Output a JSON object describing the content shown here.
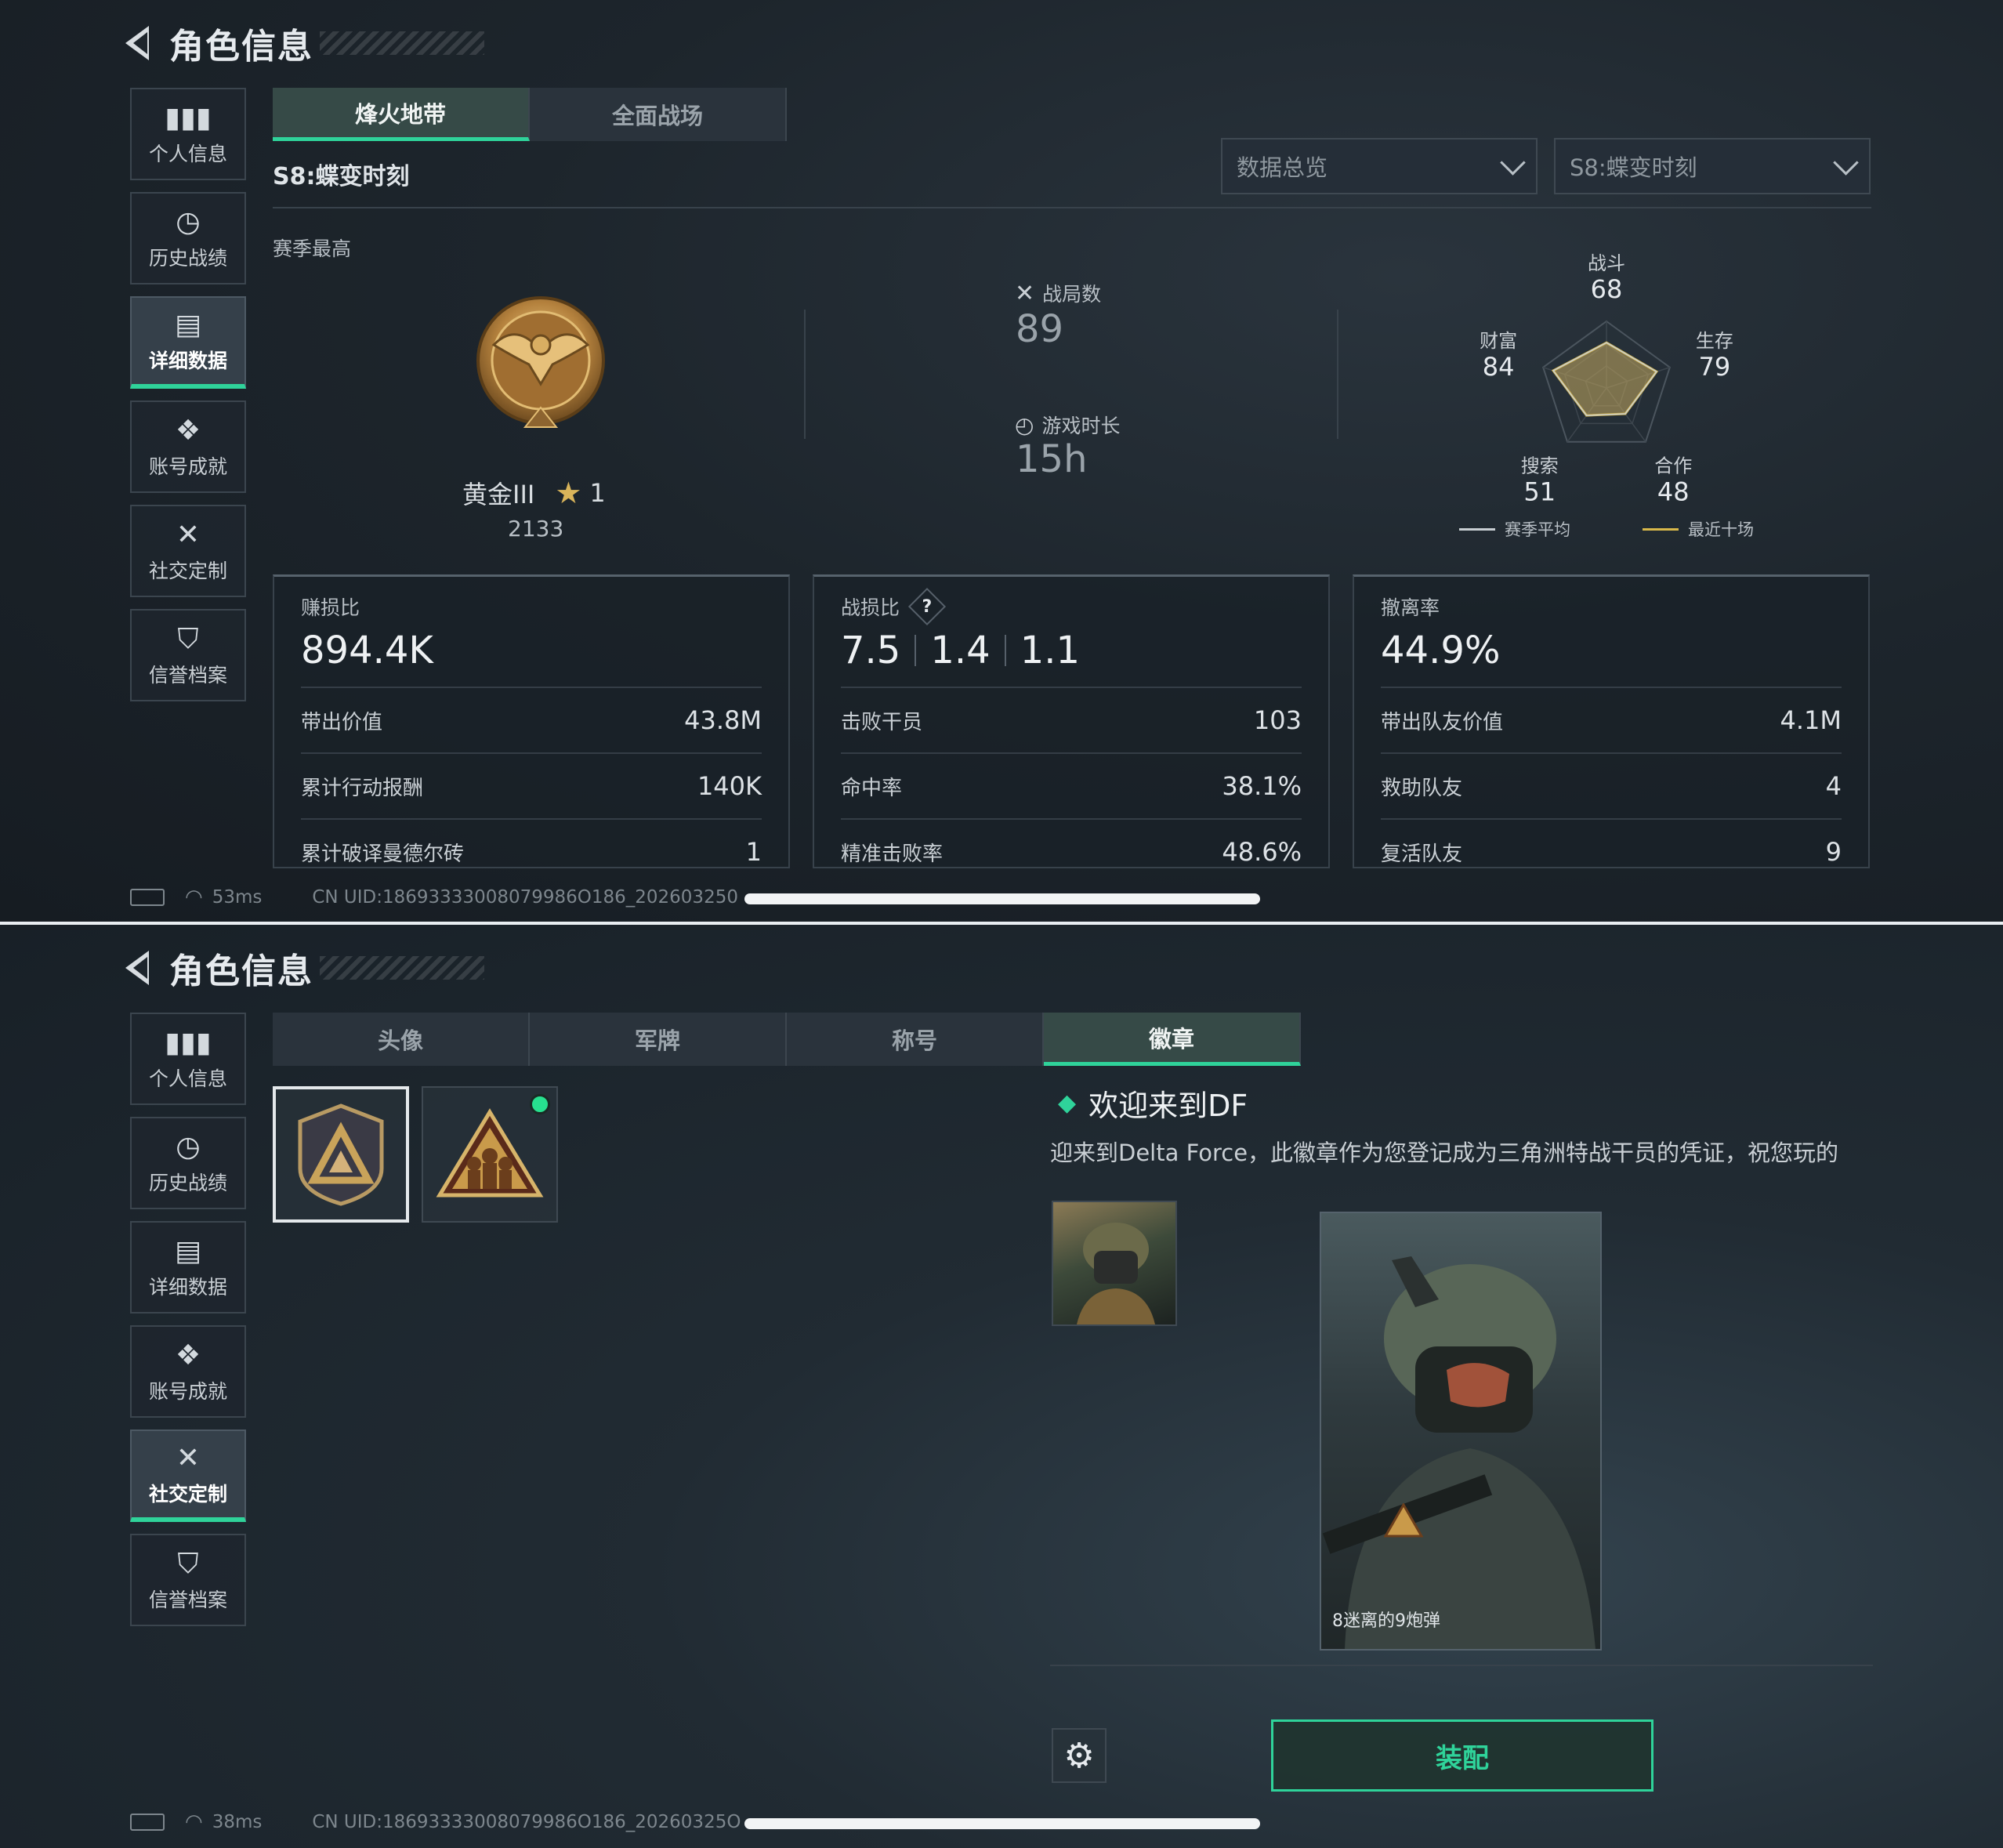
{
  "header": {
    "title": "角色信息"
  },
  "sidebar": {
    "items": [
      {
        "label": "个人信息",
        "icon": "bar-chart-icon"
      },
      {
        "label": "历史战绩",
        "icon": "clock-icon"
      },
      {
        "label": "详细数据",
        "icon": "cards-icon"
      },
      {
        "label": "账号成就",
        "icon": "medal-icon"
      },
      {
        "label": "社交定制",
        "icon": "tools-icon"
      },
      {
        "label": "信誉档案",
        "icon": "shield-icon"
      }
    ]
  },
  "screen1": {
    "tabs": [
      "烽火地带",
      "全面战场"
    ],
    "season_label": "S8:蝶变时刻",
    "dropdown_overview": "数据总览",
    "dropdown_season": "S8:蝶变时刻",
    "season_best_label": "赛季最高",
    "rank_name": "黄金III",
    "rank_stars": "1",
    "rank_score": "2133",
    "matches_label": "战局数",
    "matches_value": "89",
    "playtime_label": "游戏时长",
    "playtime_value": "15h",
    "radar": {
      "axes": [
        {
          "label": "战斗",
          "value": "68",
          "score": 0.68
        },
        {
          "label": "生存",
          "value": "79",
          "score": 0.79
        },
        {
          "label": "合作",
          "value": "48",
          "score": 0.48
        },
        {
          "label": "搜索",
          "value": "51",
          "score": 0.51
        },
        {
          "label": "财富",
          "value": "84",
          "score": 0.84
        }
      ],
      "legend_season": "赛季平均",
      "legend_recent": "最近十场",
      "color_season": "#c8ced3",
      "color_recent": "#d8b84a"
    },
    "cards": [
      {
        "title": "赚损比",
        "big": "894.4K",
        "rows": [
          {
            "label": "带出价值",
            "value": "43.8M"
          },
          {
            "label": "累计行动报酬",
            "value": "140K"
          },
          {
            "label": "累计破译曼德尔砖",
            "value": "1"
          }
        ]
      },
      {
        "title": "战损比",
        "help": "?",
        "big_parts": [
          "7.5",
          "1.4",
          "1.1"
        ],
        "rows": [
          {
            "label": "击败干员",
            "value": "103"
          },
          {
            "label": "命中率",
            "value": "38.1%"
          },
          {
            "label": "精准击败率",
            "value": "48.6%"
          }
        ]
      },
      {
        "title": "撤离率",
        "big": "44.9%",
        "rows": [
          {
            "label": "带出队友价值",
            "value": "4.1M"
          },
          {
            "label": "救助队友",
            "value": "4"
          },
          {
            "label": "复活队友",
            "value": "9"
          }
        ]
      }
    ],
    "ping": "53ms",
    "uid": "CN UID:18693333008079986O186_202603250"
  },
  "screen2": {
    "tabs": [
      "头像",
      "军牌",
      "称号",
      "徽章"
    ],
    "badge_title": "欢迎来到DF",
    "badge_desc": "迎来到Delta Force，此徽章作为您登记成为三角洲特战干员的凭证，祝您玩的",
    "card_caption": "8迷离的9炮弹",
    "equip_label": "装配",
    "ping": "38ms",
    "uid": "CN UID:18693333008079986O186_20260325O"
  },
  "colors": {
    "accent": "#2fd39a",
    "gold": "#c9a35a"
  }
}
